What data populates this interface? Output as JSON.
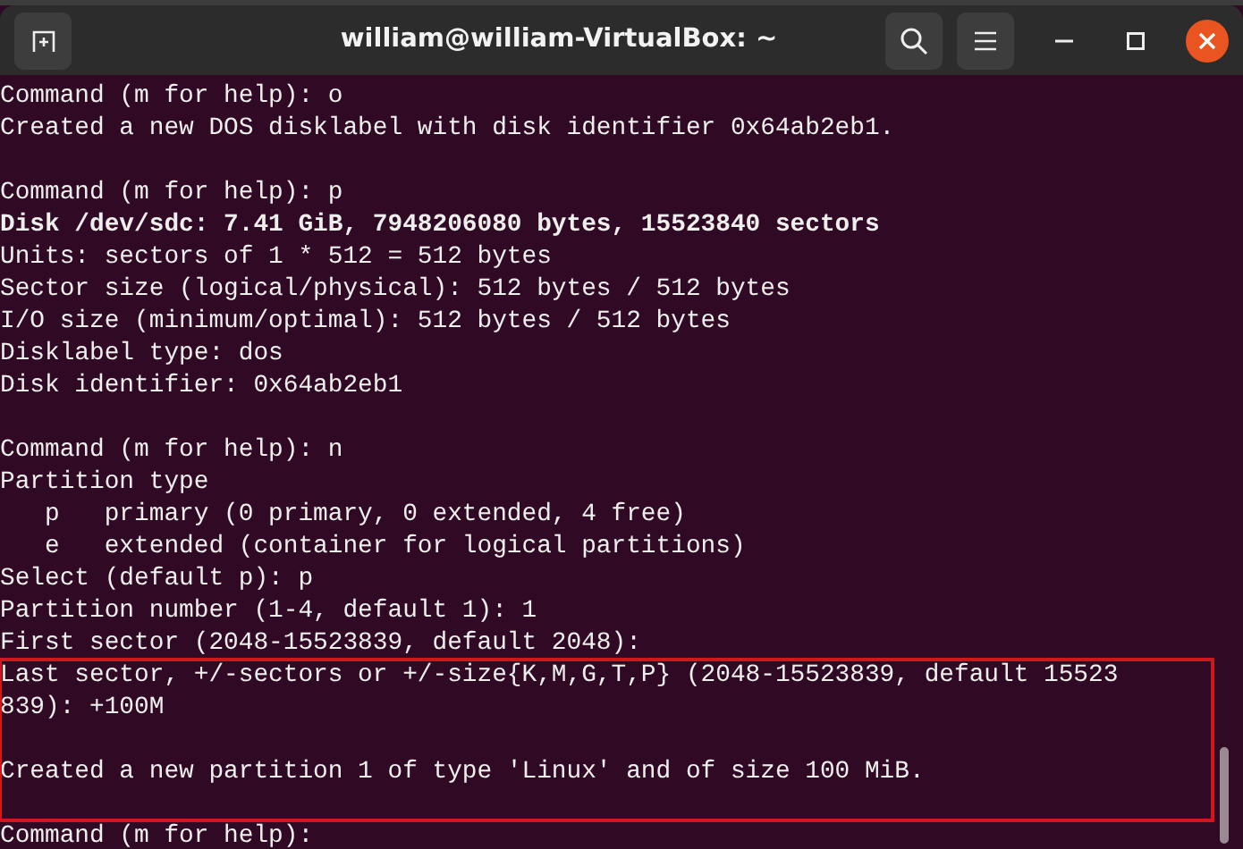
{
  "window": {
    "title": "william@william-VirtualBox: ~"
  },
  "blocks": [
    {
      "kind": "plain",
      "lines": [
        {
          "kind": "text",
          "text": "Command (m for help): o",
          "bold": false
        },
        {
          "kind": "text",
          "text": "Created a new DOS disklabel with disk identifier 0x64ab2eb1.",
          "bold": false
        },
        {
          "kind": "blank"
        },
        {
          "kind": "text",
          "text": "Command (m for help): p",
          "bold": false
        },
        {
          "kind": "text",
          "text": "Disk /dev/sdc: 7.41 GiB, 7948206080 bytes, 15523840 sectors",
          "bold": true
        },
        {
          "kind": "text",
          "text": "Units: sectors of 1 * 512 = 512 bytes",
          "bold": false
        },
        {
          "kind": "text",
          "text": "Sector size (logical/physical): 512 bytes / 512 bytes",
          "bold": false
        },
        {
          "kind": "text",
          "text": "I/O size (minimum/optimal): 512 bytes / 512 bytes",
          "bold": false
        },
        {
          "kind": "text",
          "text": "Disklabel type: dos",
          "bold": false
        },
        {
          "kind": "text",
          "text": "Disk identifier: 0x64ab2eb1",
          "bold": false
        },
        {
          "kind": "blank"
        },
        {
          "kind": "text",
          "text": "Command (m for help): n",
          "bold": false
        },
        {
          "kind": "text",
          "text": "Partition type",
          "bold": false
        },
        {
          "kind": "text",
          "text": "   p   primary (0 primary, 0 extended, 4 free)",
          "bold": false
        },
        {
          "kind": "text",
          "text": "   e   extended (container for logical partitions)",
          "bold": false
        },
        {
          "kind": "text",
          "text": "Select (default p): p",
          "bold": false
        },
        {
          "kind": "text",
          "text": "Partition number (1-4, default 1): 1",
          "bold": false
        },
        {
          "kind": "text",
          "text": "First sector (2048-15523839, default 2048):",
          "bold": false
        }
      ]
    },
    {
      "kind": "highlight",
      "lines": [
        {
          "kind": "text",
          "text": "Last sector, +/-sectors or +/-size{K,M,G,T,P} (2048-15523839, default 15523",
          "bold": false
        },
        {
          "kind": "text",
          "text": "839): +100M",
          "bold": false
        },
        {
          "kind": "blank"
        },
        {
          "kind": "text",
          "text": "Created a new partition 1 of type 'Linux' and of size 100 MiB.",
          "bold": false
        },
        {
          "kind": "blank"
        }
      ]
    },
    {
      "kind": "plain",
      "lines": [
        {
          "kind": "text",
          "text": "Command (m for help):",
          "bold": false
        }
      ]
    }
  ]
}
